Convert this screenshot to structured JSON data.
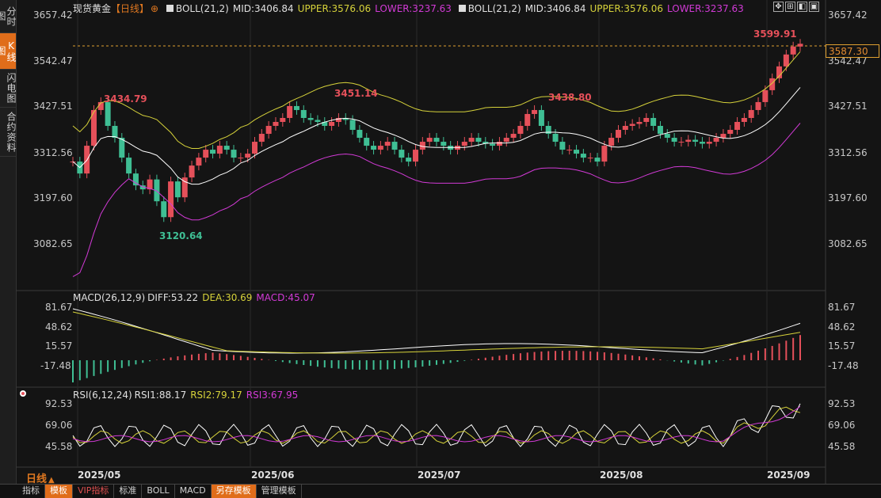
{
  "sidebar": {
    "items": [
      {
        "label": "分时图",
        "active": false
      },
      {
        "label": "K线图",
        "active": true
      },
      {
        "label": "闪电图",
        "active": false
      },
      {
        "label": "合约资料",
        "active": false
      }
    ]
  },
  "header": {
    "instrument": "现货黄金",
    "period_tag": "【日线】",
    "add_icon": "plus-circle-icon",
    "boll_a": {
      "name": "BOLL(21,2)",
      "mid": "MID:3406.84",
      "upper": "UPPER:3576.06",
      "lower": "LOWER:3237.63"
    },
    "boll_b": {
      "name": "BOLL(21,2)",
      "mid": "MID:3406.84",
      "upper": "UPPER:3576.06",
      "lower": "LOWER:3237.63"
    },
    "toolbar_icons": [
      "move-icon",
      "zoom-icon",
      "prev-icon",
      "window-icon"
    ]
  },
  "price_axis": {
    "labels": [
      "3657.42",
      "3542.47",
      "3427.51",
      "3312.56",
      "3197.60",
      "3082.65"
    ],
    "last_price": "3587.30"
  },
  "annotations": {
    "high1": "3434.79",
    "high2": "3451.14",
    "high3": "3438.80",
    "high4": "3599.91",
    "low1": "3120.64"
  },
  "macd": {
    "title": "MACD(26,12,9)",
    "diff": "DIFF:53.22",
    "dea": "DEA:30.69",
    "macd": "MACD:45.07",
    "axis": [
      "81.67",
      "48.62",
      "15.57",
      "-17.48"
    ]
  },
  "rsi": {
    "title": "RSI(6,12,24)",
    "rsi1": "RSI1:88.17",
    "rsi2": "RSI2:79.17",
    "rsi3": "RSI3:67.95",
    "axis": [
      "92.53",
      "69.06",
      "45.58"
    ]
  },
  "dates": [
    "2025/05",
    "2025/06",
    "2025/07",
    "2025/08",
    "2025/09"
  ],
  "period_label": "日线",
  "bottom_tabs": [
    {
      "label": "指标",
      "style": "normal"
    },
    {
      "label": "模板",
      "style": "orange"
    },
    {
      "label": "VIP指标",
      "style": "red"
    },
    {
      "label": "标准",
      "style": "normal"
    },
    {
      "label": "BOLL",
      "style": "normal"
    },
    {
      "label": "MACD",
      "style": "normal"
    },
    {
      "label": "另存模板",
      "style": "orange"
    },
    {
      "label": "管理模板",
      "style": "normal"
    }
  ],
  "colors": {
    "up": "#e5505a",
    "down": "#3fbf94",
    "mid": "#ffffff",
    "upper": "#d6d23a",
    "lower": "#d23ad6",
    "accent": "#e06d1a"
  },
  "chart_data": {
    "type": "candlestick",
    "price_axis_ticks": [
      3657.42,
      3542.47,
      3427.51,
      3312.56,
      3197.6,
      3082.65
    ],
    "last_close": 3587.3,
    "marked_high": 3599.91,
    "marked_low": 3120.64
  }
}
